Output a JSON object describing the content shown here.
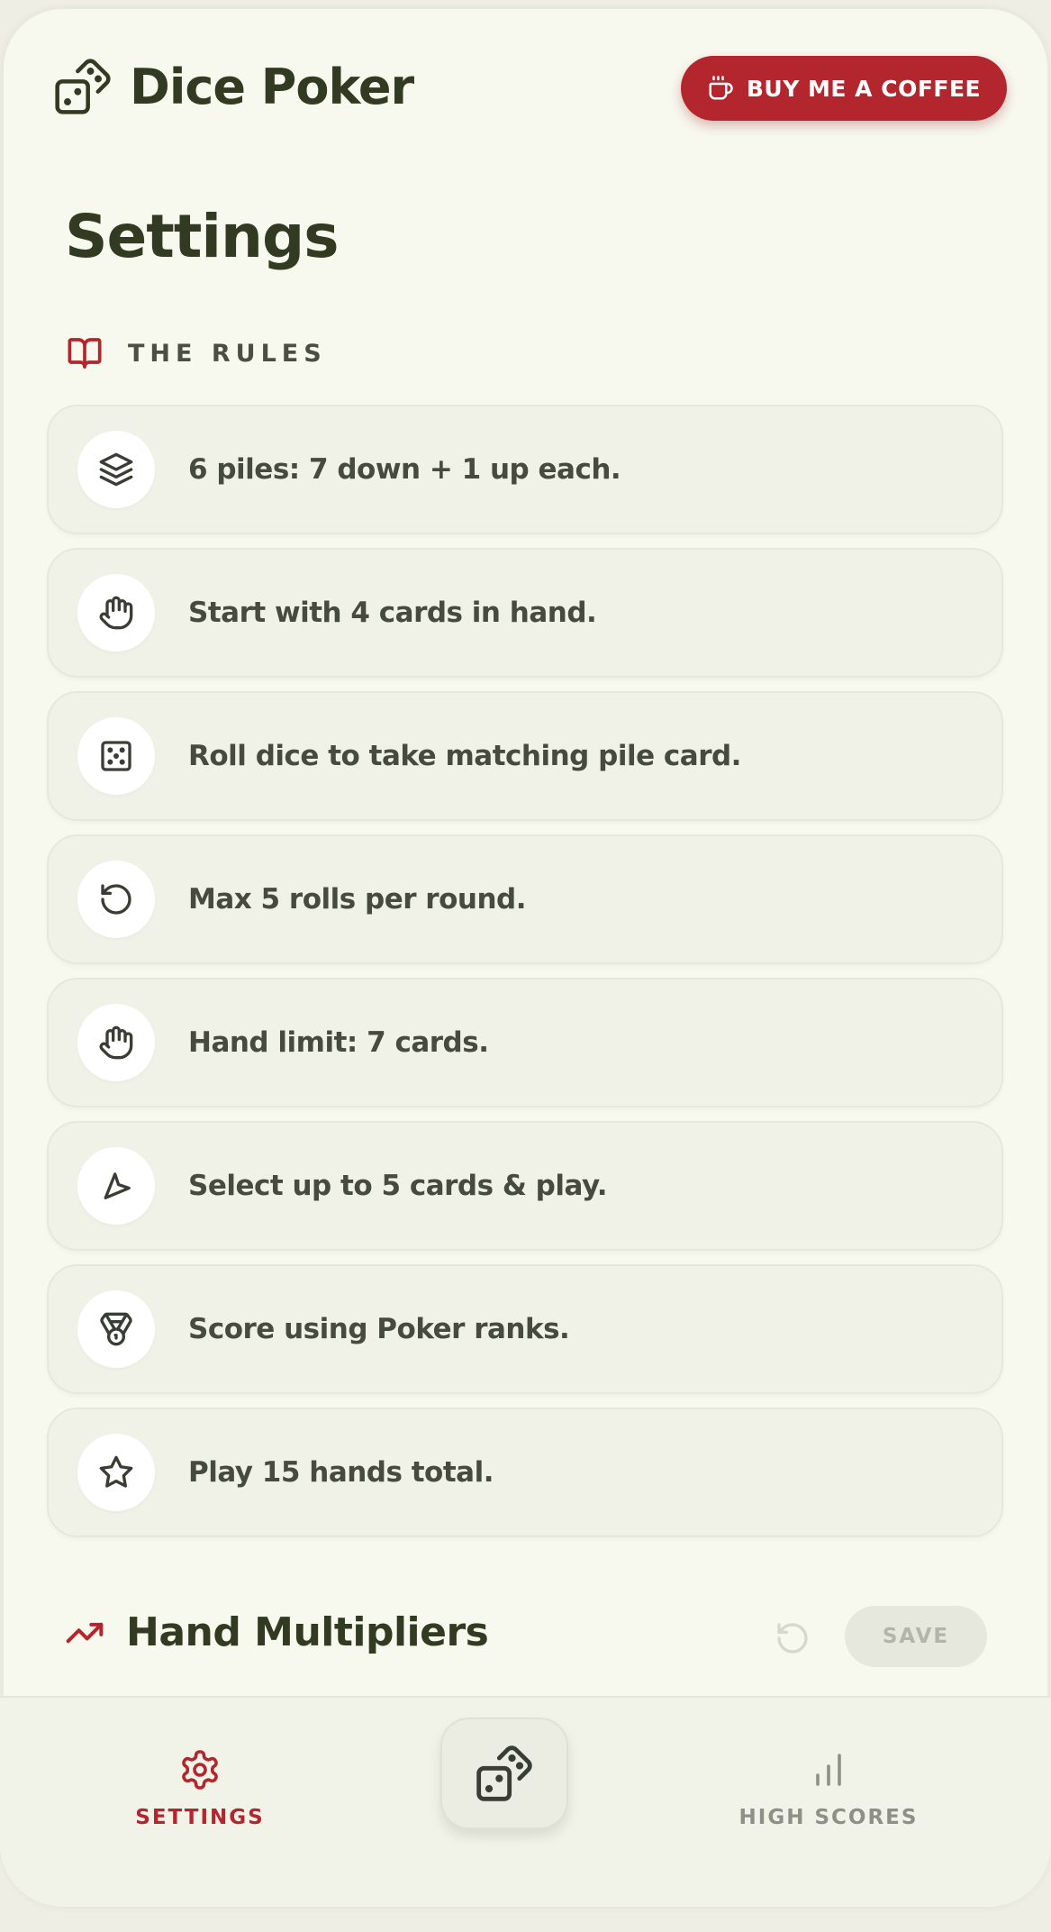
{
  "header": {
    "title": "Dice Poker",
    "coffee_label": "BUY ME A COFFEE"
  },
  "page": {
    "title": "Settings"
  },
  "rules": {
    "heading": "THE RULES",
    "items": [
      {
        "icon": "layers-icon",
        "text": "6 piles: 7 down + 1 up each."
      },
      {
        "icon": "hand-icon",
        "text": "Start with 4 cards in hand."
      },
      {
        "icon": "dice-icon",
        "text": "Roll dice to take matching pile card."
      },
      {
        "icon": "rotate-icon",
        "text": "Max 5 rolls per round."
      },
      {
        "icon": "hand-icon",
        "text": "Hand limit: 7 cards."
      },
      {
        "icon": "pointer-icon",
        "text": "Select up to 5 cards & play."
      },
      {
        "icon": "medal-icon",
        "text": "Score using Poker ranks."
      },
      {
        "icon": "star-icon",
        "text": "Play 15 hands total."
      }
    ]
  },
  "multipliers": {
    "title": "Hand Multipliers",
    "save_label": "SAVE"
  },
  "nav": {
    "settings_label": "SETTINGS",
    "scores_label": "HIGH SCORES"
  },
  "colors": {
    "accent": "#b3262d",
    "text_dark": "#323b22",
    "background": "#f7f8ee"
  }
}
